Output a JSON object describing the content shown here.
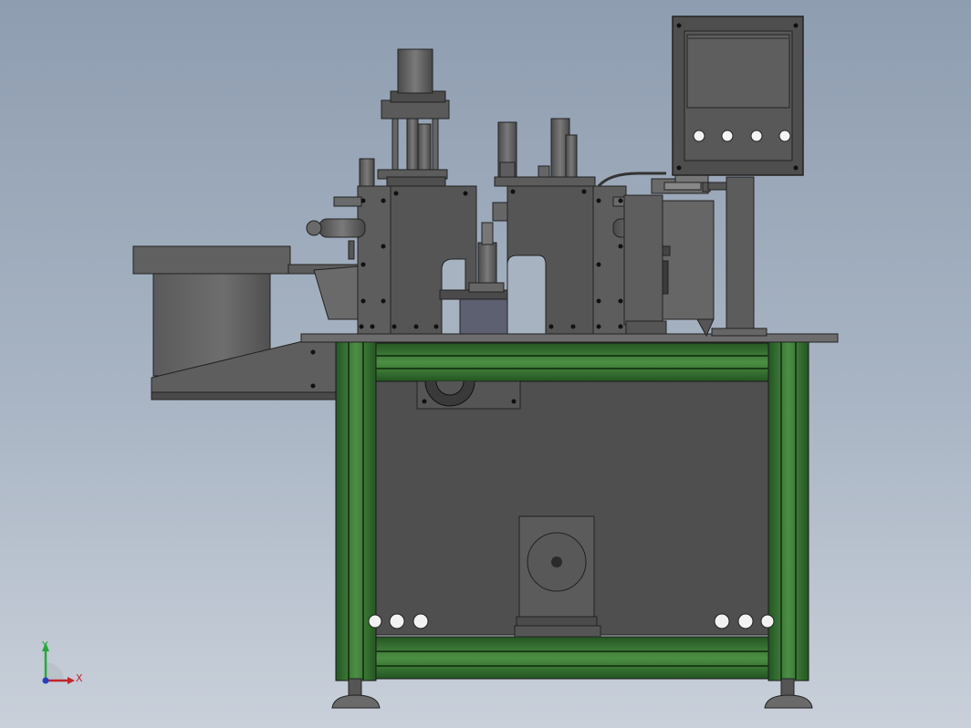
{
  "scene": {
    "background_top": "#8e9db0",
    "background_bottom": "#c9d0da",
    "frame_color": "#2f6b2d",
    "frame_highlight": "#4c8f44",
    "panel_color": "#4f4f4f",
    "steel_color": "#6a6a6a",
    "steel_dark": "#3d3d3d",
    "steel_light": "#8a8a8a"
  },
  "axis_triad": {
    "x_label": "X",
    "y_label": "Y",
    "x_color": "#c0262b",
    "y_color": "#27a83c",
    "z_color": "#2a3fbf"
  }
}
